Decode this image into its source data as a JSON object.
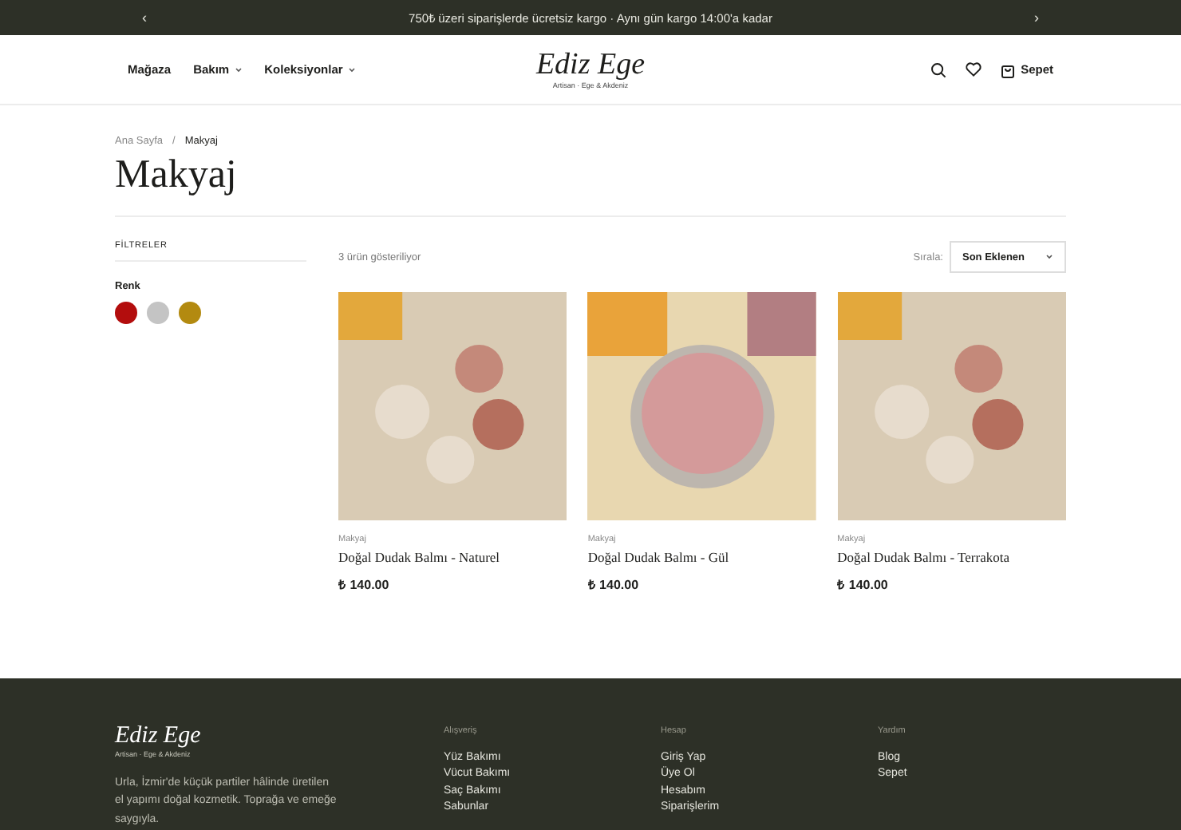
{
  "announcement": {
    "text": "750₺ üzeri siparişlerde ücretsiz kargo · Aynı gün kargo 14:00'a kadar",
    "prev": "‹",
    "next": "›"
  },
  "header": {
    "nav": [
      {
        "label": "Mağaza",
        "dropdown": false
      },
      {
        "label": "Bakım",
        "dropdown": true
      },
      {
        "label": "Koleksiyonlar",
        "dropdown": true
      }
    ],
    "logo": "Ediz Ege",
    "tagline": "Artisan · Ege & Akdeniz",
    "cart": "Sepet"
  },
  "breadcrumb": {
    "separator": "/",
    "items": [
      "Ana Sayfa",
      "Makyaj"
    ]
  },
  "title": "Makyaj",
  "filters": {
    "heading": "FİLTRELER",
    "group": "Renk",
    "colors": [
      {
        "color": "#b30d0d"
      },
      {
        "color": "#c4c4c4"
      },
      {
        "color": "#b38a10"
      }
    ]
  },
  "toolbar": {
    "count": "3 ürün gösteriliyor",
    "sort_label": "Sırala:",
    "sort_value": "Son Eklenen"
  },
  "products": [
    {
      "category": "Makyaj",
      "name": "Doğal Dudak Balmı - Naturel",
      "price": "₺ 140.00",
      "kind": "tins"
    },
    {
      "category": "Makyaj",
      "name": "Doğal Dudak Balmı - Gül",
      "price": "₺ 140.00",
      "kind": "jar"
    },
    {
      "category": "Makyaj",
      "name": "Doğal Dudak Balmı - Terrakota",
      "price": "₺ 140.00",
      "kind": "tins"
    }
  ],
  "footer": {
    "logo": "Ediz Ege",
    "tagline": "Artisan · Ege & Akdeniz",
    "about": "Urla, İzmir'de küçük partiler hâlinde üretilen el yapımı doğal kozmetik. Toprağa ve emeğe saygıyla.",
    "columns": [
      {
        "heading": "Alışveriş",
        "links": [
          "Yüz Bakımı",
          "Vücut Bakımı",
          "Saç Bakımı",
          "Sabunlar"
        ]
      },
      {
        "heading": "Hesap",
        "links": [
          "Giriş Yap",
          "Üye Ol",
          "Hesabım",
          "Siparişlerim"
        ]
      },
      {
        "heading": "Yardım",
        "links": [
          "Blog",
          "Sepet"
        ]
      }
    ]
  }
}
